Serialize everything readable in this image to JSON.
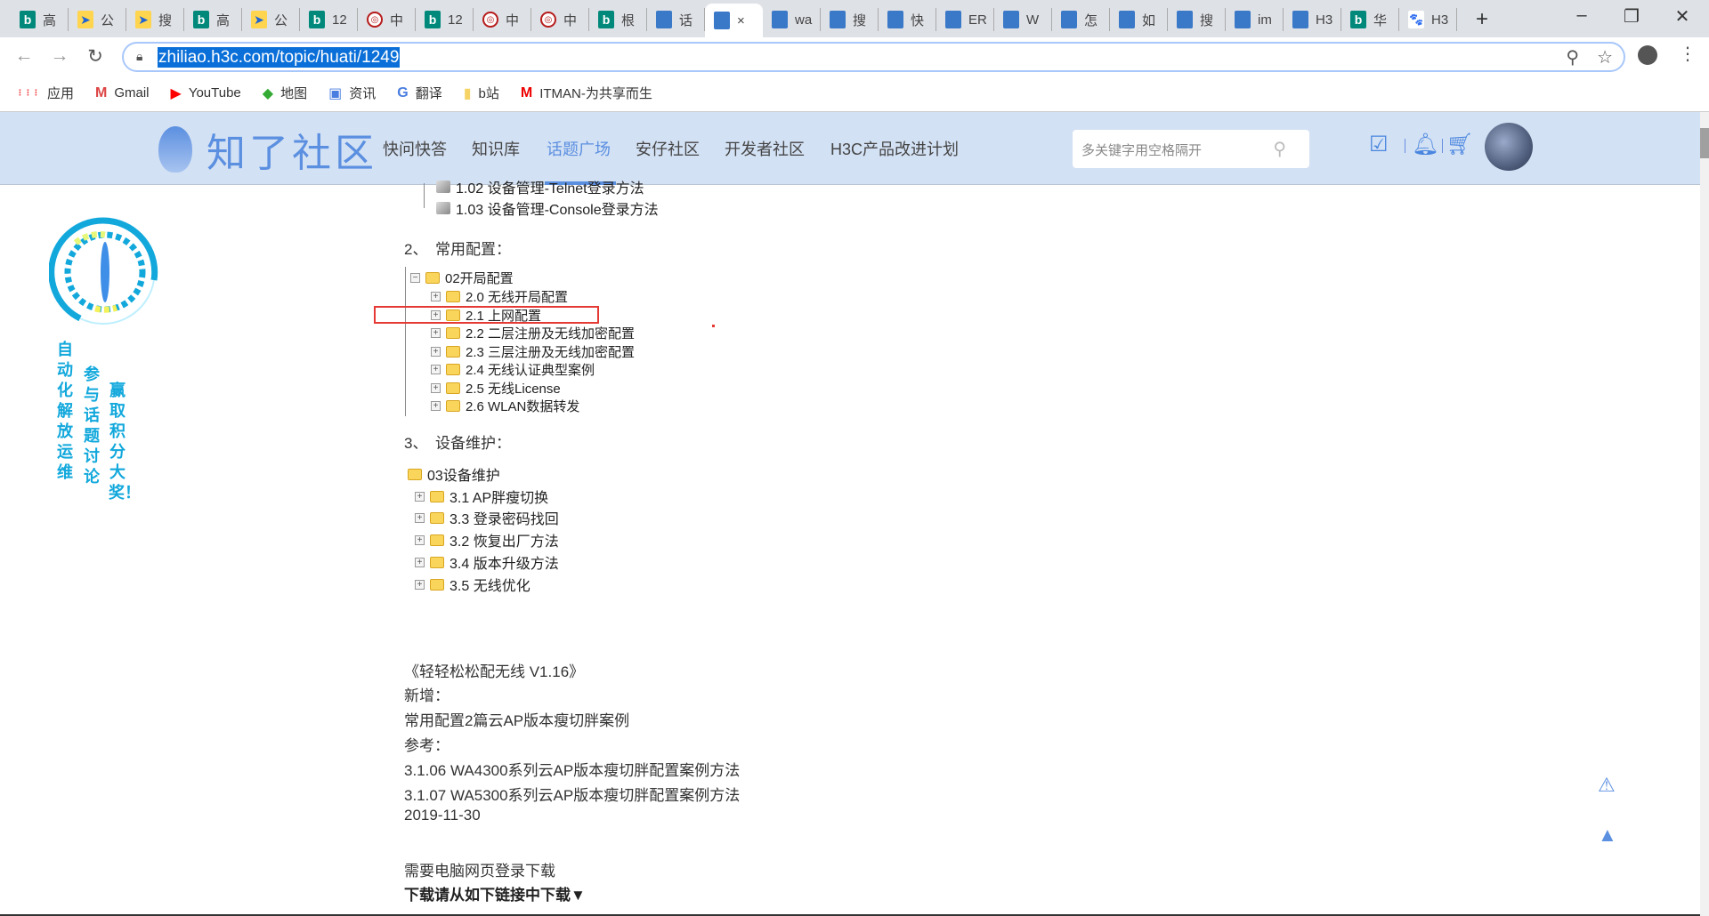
{
  "browser": {
    "tabs": [
      {
        "icon": "bing",
        "text": "高"
      },
      {
        "icon": "map",
        "text": "公"
      },
      {
        "icon": "map",
        "text": "搜"
      },
      {
        "icon": "bing",
        "text": "高"
      },
      {
        "icon": "map",
        "text": "公"
      },
      {
        "icon": "bing",
        "text": "12"
      },
      {
        "icon": "rail",
        "text": "中"
      },
      {
        "icon": "bing",
        "text": "12"
      },
      {
        "icon": "rail",
        "text": "中"
      },
      {
        "icon": "rail",
        "text": "中"
      },
      {
        "icon": "bing",
        "text": "根"
      },
      {
        "icon": "h3c",
        "text": "话"
      },
      {
        "icon": "h3c",
        "text": "×",
        "active": true
      },
      {
        "icon": "h3c",
        "text": "wa"
      },
      {
        "icon": "h3c",
        "text": "搜"
      },
      {
        "icon": "h3c",
        "text": "快"
      },
      {
        "icon": "h3c",
        "text": "ER"
      },
      {
        "icon": "h3c",
        "text": "W"
      },
      {
        "icon": "h3c",
        "text": "怎"
      },
      {
        "icon": "h3c",
        "text": "如"
      },
      {
        "icon": "h3c",
        "text": "搜"
      },
      {
        "icon": "h3c",
        "text": "im"
      },
      {
        "icon": "h3c",
        "text": "H3"
      },
      {
        "icon": "bing",
        "text": "华"
      },
      {
        "icon": "baidu",
        "text": "H3"
      }
    ],
    "new_tab": "+",
    "minimize": "–",
    "restore": "❐",
    "close": "✕",
    "url": "zhiliao.h3c.com/topic/huati/1249",
    "bookmarks": [
      {
        "icon": "apps-icon",
        "label": "应用"
      },
      {
        "icon": "gmail-icon",
        "label": "Gmail"
      },
      {
        "icon": "youtube-icon",
        "label": "YouTube"
      },
      {
        "icon": "maps-icon",
        "label": "地图"
      },
      {
        "icon": "news-icon",
        "label": "资讯"
      },
      {
        "icon": "translate-icon",
        "label": "翻译"
      },
      {
        "icon": "folder-icon",
        "label": "b站"
      },
      {
        "icon": "itman-icon",
        "label": "ITMAN-为共享而生"
      }
    ]
  },
  "site": {
    "logo": "知了社区",
    "nav": [
      "快问快答",
      "知识库",
      "话题广场",
      "安仔社区",
      "开发者社区",
      "H3C产品改进计划"
    ],
    "active_nav": "话题广场",
    "search_placeholder": "多关键字用空格隔开",
    "accent": "#5b8fe0"
  },
  "sidebar": {
    "slogan": [
      "自动化解放运维",
      "参与话题讨论",
      "赢取积分大奖！"
    ]
  },
  "content": {
    "tree1": [
      "1.02 设备管理-Telnet登录方法",
      "1.03 设备管理-Console登录方法"
    ],
    "section2": "2、　常用配置：",
    "tree2_root": "02开局配置",
    "tree2": [
      "2.0 无线开局配置",
      "2.1 上网配置",
      "2.2 二层注册及无线加密配置",
      "2.3 三层注册及无线加密配置",
      "2.4 无线认证典型案例",
      "2.5 无线License",
      "2.6 WLAN数据转发"
    ],
    "section3": "3、　设备维护：",
    "tree3_root": "03设备维护",
    "tree3": [
      "3.1 AP胖瘦切换",
      "3.3 登录密码找回",
      "3.2 恢复出厂方法",
      "3.4 版本升级方法",
      "3.5 无线优化"
    ],
    "notes": [
      "《轻轻松松配无线 V1.16》",
      "新增：",
      "常用配置2篇云AP版本瘦切胖案例",
      "参考：",
      "3.1.06 WA4300系列云AP版本瘦切胖配置案例方法",
      "3.1.07 WA5300系列云AP版本瘦切胖配置案例方法",
      "2019-11-30"
    ],
    "login_note": "需要电脑网页登录下载",
    "download_note": "下载请从如下链接中下载▼"
  }
}
